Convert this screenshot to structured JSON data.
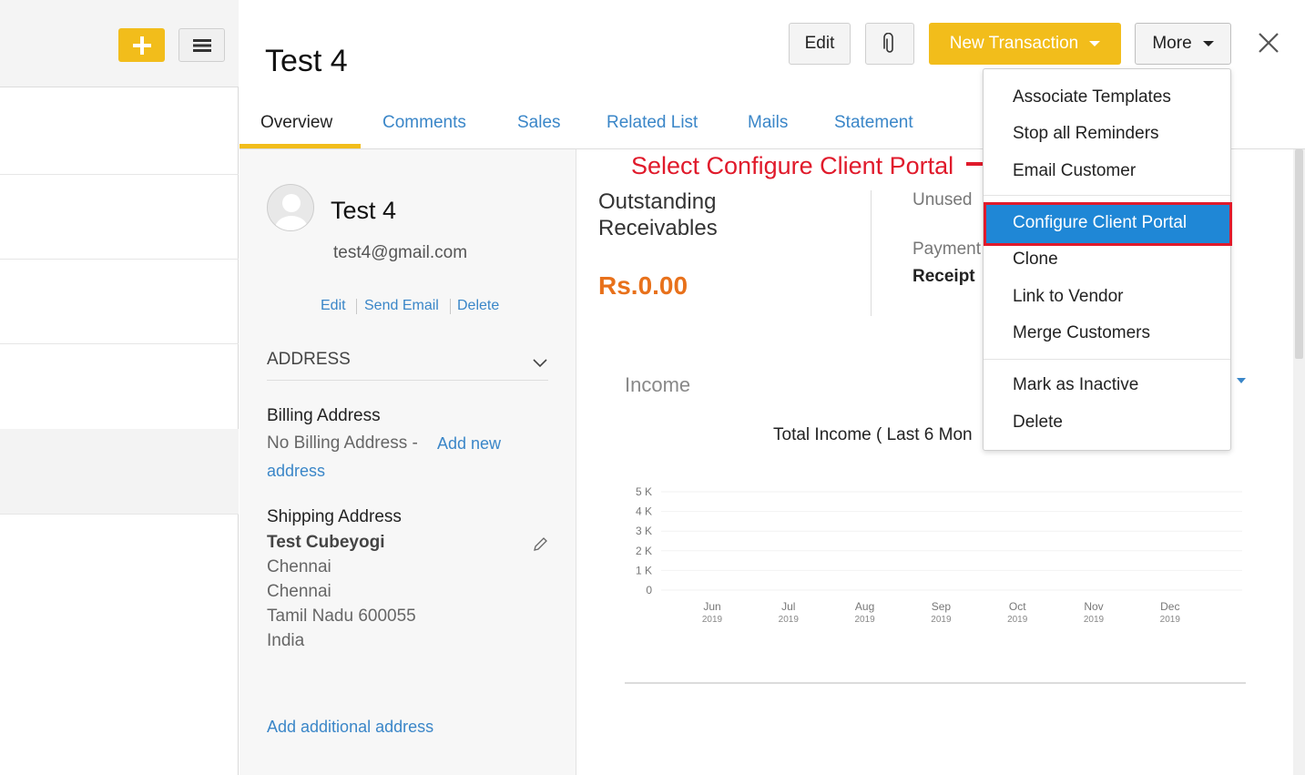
{
  "left_panel": {
    "add_icon": "plus-icon",
    "menu_icon": "hamburger-icon"
  },
  "header": {
    "title": "Test 4",
    "edit_label": "Edit",
    "attach_icon": "paperclip-icon",
    "new_transaction_label": "New Transaction",
    "more_label": "More",
    "close_icon": "close-icon"
  },
  "tabs": [
    {
      "label": "Overview",
      "active": true
    },
    {
      "label": "Comments"
    },
    {
      "label": "Sales"
    },
    {
      "label": "Related List"
    },
    {
      "label": "Mails"
    },
    {
      "label": "Statement"
    }
  ],
  "contact": {
    "name": "Test 4",
    "email": "test4@gmail.com",
    "actions": [
      "Edit",
      "Send Email",
      "Delete"
    ],
    "address_heading": "ADDRESS",
    "billing_heading": "Billing Address",
    "billing_none": "No Billing Address -",
    "billing_add_link_1": "Add new",
    "billing_add_link_2": "address",
    "shipping_heading": "Shipping Address",
    "shipping_lines": [
      "Test Cubeyogi",
      "Chennai",
      "Chennai",
      "Tamil Nadu 600055",
      "India"
    ],
    "add_additional": "Add additional address"
  },
  "summary": {
    "outstanding_label_1": "Outstanding",
    "outstanding_label_2": "Receivables",
    "outstanding_value": "Rs.0.00",
    "unused_label": "Unused",
    "payment_label": "Payment",
    "receipt_label": "Receipt"
  },
  "income": {
    "heading": "Income",
    "chart_title": "Total Income ( Last 6 Mon"
  },
  "chart_data": {
    "type": "bar",
    "title": "Total Income ( Last 6 Mon",
    "categories": [
      "Jun",
      "Jul",
      "Aug",
      "Sep",
      "Oct",
      "Nov",
      "Dec"
    ],
    "category_years": [
      "2019",
      "2019",
      "2019",
      "2019",
      "2019",
      "2019",
      "2019"
    ],
    "values": [
      0,
      0,
      0,
      0,
      0,
      0,
      0
    ],
    "yticks": [
      "0",
      "1 K",
      "2 K",
      "3 K",
      "4 K",
      "5 K"
    ],
    "ylim": [
      0,
      5000
    ]
  },
  "dropdown": {
    "items_top": [
      "Associate Templates",
      "Stop all Reminders",
      "Email Customer"
    ],
    "highlighted": "Configure Client Portal",
    "items_mid": [
      "Clone",
      "Link to Vendor",
      "Merge Customers"
    ],
    "items_bottom": [
      "Mark as Inactive",
      "Delete"
    ]
  },
  "annotation": "Select Configure Client Portal",
  "colors": {
    "accent": "#f2bd1b",
    "link": "#3a86c8",
    "highlight": "#1f87d6",
    "annotation": "#e01a2b",
    "amount": "#e8711b"
  }
}
